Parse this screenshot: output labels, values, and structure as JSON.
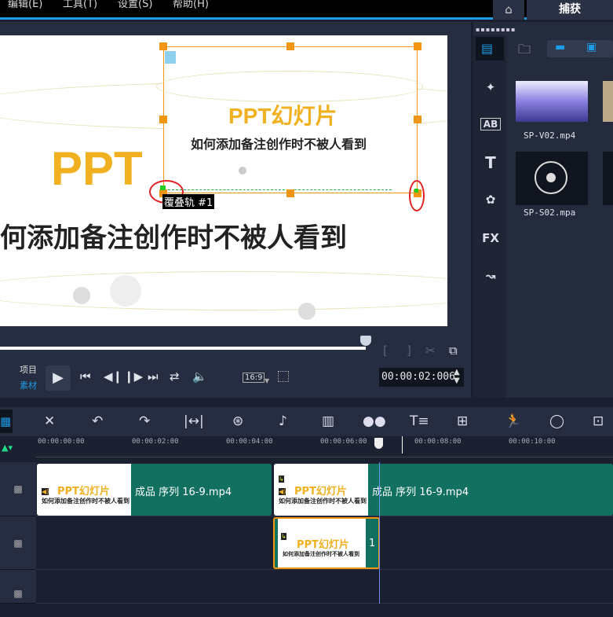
{
  "menu": {
    "items": [
      "编辑(E)",
      "工具(T)",
      "设置(S)",
      "帮助(H)"
    ],
    "capture": "捕获",
    "home_icon": "home-icon"
  },
  "preview": {
    "title": "PPT幻灯片",
    "subtitle": "如何添加备注创作时不被人看到",
    "big_title": "PPT",
    "big_subtitle": "何添加备注创作时不被人看到",
    "overlay_label": "覆叠轨 #1"
  },
  "player": {
    "project_label": "项目",
    "clip_label": "素材",
    "aspect": "16:9",
    "timecode": "00:00:02:006",
    "progress_percent": 80
  },
  "library": {
    "items": [
      {
        "name": "SP-V02.mp4"
      },
      {
        "name": "SP-S02.mpa"
      }
    ],
    "side_tabs": [
      "media",
      "instant-project",
      "transition",
      "title",
      "graphics",
      "filter",
      "path"
    ],
    "ab_label": "AB",
    "t_label": "T",
    "fx_label": "FX"
  },
  "timeline": {
    "ruler": [
      "00:00:00:00",
      "00:00:02:00",
      "00:00:04:00",
      "00:00:06:00",
      "00:00:08:00",
      "00:00:10:00"
    ],
    "clips": {
      "video1": "成品 序列 16-9.mp4",
      "video2": "成品 序列 16-9.mp4",
      "overlay": "1"
    },
    "thumb_title": "PPT幻灯片",
    "thumb_sub": "如何添加备注创作时不被人看到"
  },
  "colors": {
    "accent": "#1d9be6",
    "clip": "#127060",
    "handle": "#f29512"
  }
}
